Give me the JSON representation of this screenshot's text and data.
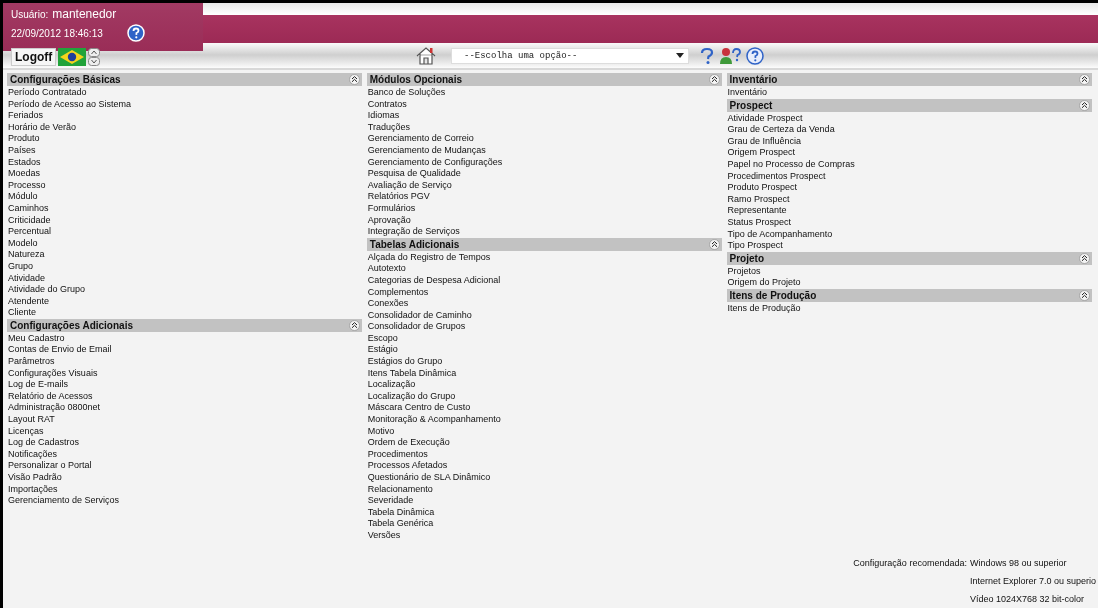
{
  "header": {
    "user_label": "Usuário:",
    "user_name": "mantenedor",
    "datetime": "22/09/2012 18:46:13",
    "logoff": "Logoff",
    "menu_select": {
      "value": "--Escolha uma opção--"
    }
  },
  "columns": [
    [
      {
        "title": "Configurações Básicas",
        "expanded": true,
        "items": [
          "Período Contratado",
          "Período de Acesso ao Sistema",
          "Feriados",
          "Horário de Verão",
          "Produto",
          "Países",
          "Estados",
          "Moedas",
          "Processo",
          "Módulo",
          "Caminhos",
          "Criticidade",
          "Percentual",
          "Modelo",
          "Natureza",
          "Grupo",
          "Atividade",
          "Atividade do Grupo",
          "Atendente",
          "Cliente"
        ]
      },
      {
        "title": "Configurações Adicionais",
        "expanded": true,
        "items": [
          "Meu Cadastro",
          "Contas de Envio de Email",
          "Parâmetros",
          "Configurações Visuais",
          "Log de E-mails",
          "Relatório de Acessos",
          "Administração 0800net",
          "Layout RAT",
          "Licenças",
          "Log de Cadastros",
          "Notificações",
          "Personalizar o Portal",
          "Visão Padrão",
          "Importações",
          "Gerenciamento de Serviços"
        ]
      }
    ],
    [
      {
        "title": "Módulos Opcionais",
        "expanded": true,
        "items": [
          "Banco de Soluções",
          "Contratos",
          "Idiomas",
          "Traduções",
          "Gerenciamento de Correio",
          "Gerenciamento de Mudanças",
          "Gerenciamento de Configurações",
          "Pesquisa de Qualidade",
          "Avaliação de Serviço",
          "Relatórios PGV",
          "Formulários",
          "Aprovação",
          "Integração de Serviços"
        ]
      },
      {
        "title": "Tabelas Adicionais",
        "expanded": true,
        "items": [
          "Alçada do Registro de Tempos",
          "Autotexto",
          "Categorias de Despesa Adicional",
          "Complementos",
          "Conexões",
          "Consolidador de Caminho",
          "Consolidador de Grupos",
          "Escopo",
          "Estágio",
          "Estágios do Grupo",
          "Itens Tabela Dinâmica",
          "Localização",
          "Localização do Grupo",
          "Máscara Centro de Custo",
          "Monitoração & Acompanhamento",
          "Motivo",
          "Ordem de Execução",
          "Procedimentos",
          "Processos Afetados",
          "Questionário de SLA Dinâmico",
          "Relacionamento",
          "Severidade",
          "Tabela Dinâmica",
          "Tabela Genérica",
          "Versões"
        ]
      }
    ],
    [
      {
        "title": "Inventário",
        "expanded": true,
        "items": [
          "Inventário"
        ]
      },
      {
        "title": "Prospect",
        "expanded": true,
        "items": [
          "Atividade Prospect",
          "Grau de Certeza da Venda",
          "Grau de Influência",
          "Origem Prospect",
          "Papel no Processo de Compras",
          "Procedimentos Prospect",
          "Produto Prospect",
          "Ramo Prospect",
          "Representante",
          "Status Prospect",
          "Tipo de Acompanhamento",
          "Tipo Prospect"
        ]
      },
      {
        "title": "Projeto",
        "expanded": true,
        "items": [
          "Projetos",
          "Origem do Projeto"
        ]
      },
      {
        "title": "Itens de Produção",
        "expanded": true,
        "items": [
          "Itens de Produção"
        ]
      }
    ]
  ],
  "footer": {
    "label": "Configuração recomendada:",
    "values": [
      "Windows 98 ou superior",
      "Internet Explorer 7.0 ou superio",
      "Vídeo 1024X768 32 bit-color"
    ]
  }
}
